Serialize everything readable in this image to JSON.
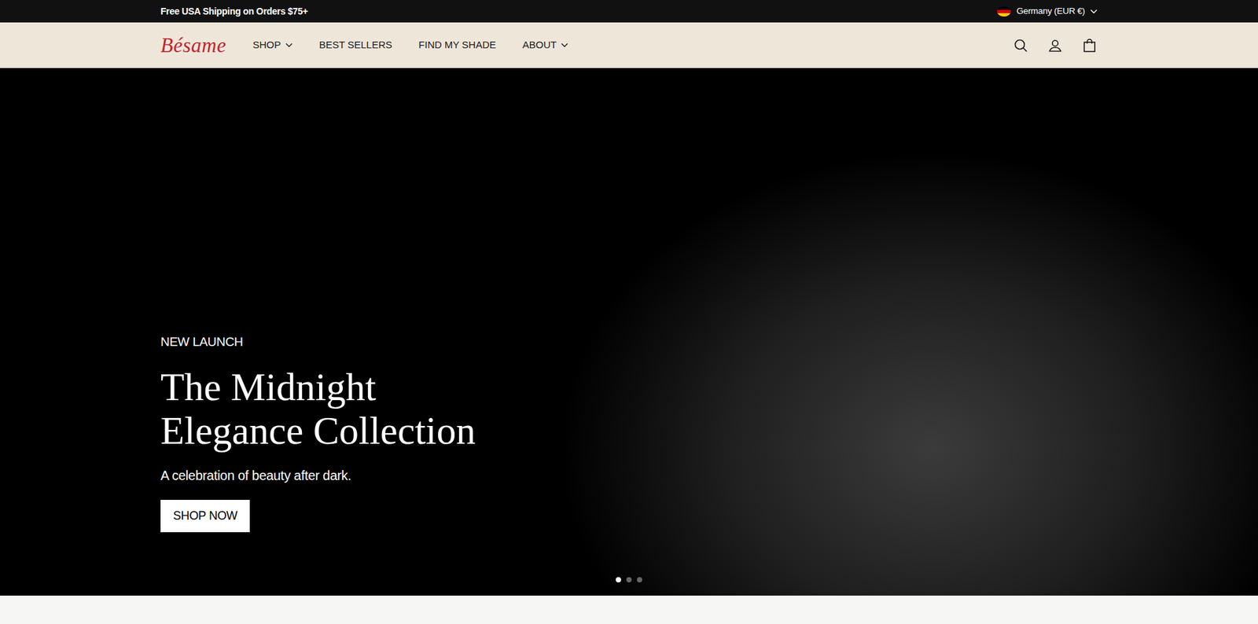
{
  "announcement": "Free USA Shipping on Orders $75+",
  "locale": {
    "label": "Germany (EUR €)"
  },
  "logo": "Bésame",
  "nav": [
    {
      "label": "SHOP",
      "dropdown": true
    },
    {
      "label": "BEST SELLERS",
      "dropdown": false
    },
    {
      "label": "FIND MY SHADE",
      "dropdown": false
    },
    {
      "label": "ABOUT",
      "dropdown": true
    }
  ],
  "hero": {
    "eyebrow": "NEW LAUNCH",
    "title_lines": [
      "The Midnight",
      "Elegance Collection"
    ],
    "subtitle": "A celebration of beauty after dark.",
    "button": "SHOP NOW"
  },
  "slides": [
    {
      "selected": true
    },
    {
      "selected": false
    },
    {
      "selected": false
    }
  ]
}
